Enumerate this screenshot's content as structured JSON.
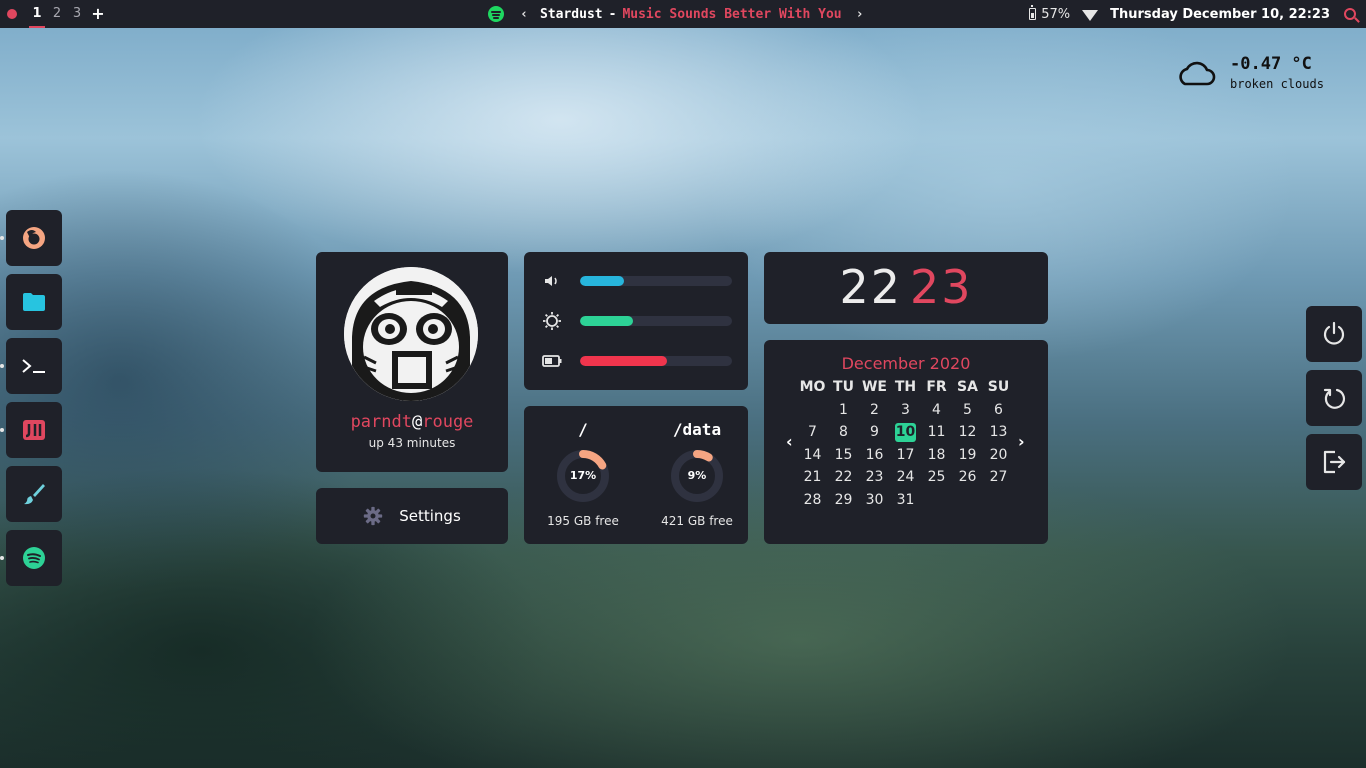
{
  "topbar": {
    "workspaces": [
      "1",
      "2",
      "3"
    ],
    "add_label": "+",
    "now_playing": {
      "artist": "Stardust",
      "separator": "-",
      "title": "Music Sounds Better With You",
      "prev_label": "‹",
      "next_label": "›"
    },
    "battery": "57%",
    "datetime": "Thursday December 10, 22:23"
  },
  "weather": {
    "temperature": "-0.47 °C",
    "description": "broken clouds",
    "icon": "cloud-icon"
  },
  "dock": [
    {
      "name": "firefox",
      "icon": "firefox-icon",
      "color": "#f5a582"
    },
    {
      "name": "files",
      "icon": "folder-icon",
      "color": "#27c4e0"
    },
    {
      "name": "terminal",
      "icon": "terminal-icon",
      "color": "#ffffff"
    },
    {
      "name": "jetbrains",
      "icon": "jetbrains-icon",
      "color": "#e0475f"
    },
    {
      "name": "paint",
      "icon": "brush-icon",
      "color": "#6fd1dd"
    },
    {
      "name": "spotify",
      "icon": "spotify-icon",
      "color": "#2dd296"
    }
  ],
  "profile": {
    "user": "parndt",
    "at": "@",
    "host": "rouge",
    "uptime": "up 43 minutes"
  },
  "settings": {
    "label": "Settings"
  },
  "sliders": {
    "volume": {
      "icon": "volume-icon",
      "level": 0.29,
      "color": "#27b5dc"
    },
    "brightness": {
      "icon": "brightness-icon",
      "level": 0.35,
      "color": "#2dd296"
    },
    "battery": {
      "icon": "battery-icon",
      "level": 0.57,
      "color": "#f0354d"
    }
  },
  "disks": [
    {
      "mount": "/",
      "percent_label": "17%",
      "percent": 17,
      "free": "195 GB free"
    },
    {
      "mount": "/data",
      "percent_label": "9%",
      "percent": 9,
      "free": "421 GB free"
    }
  ],
  "clock": {
    "hours": "22",
    "minutes": "23"
  },
  "calendar": {
    "title": "December 2020",
    "weekdays": [
      "MO",
      "TU",
      "WE",
      "TH",
      "FR",
      "SA",
      "SU"
    ],
    "first_weekday_index": 1,
    "days_in_month": 31,
    "today": 10,
    "prev_label": "‹",
    "next_label": "›"
  },
  "power": [
    {
      "name": "power",
      "icon": "power-icon"
    },
    {
      "name": "restart",
      "icon": "restart-icon"
    },
    {
      "name": "logout",
      "icon": "logout-icon"
    }
  ],
  "colors": {
    "accent": "#e0475f",
    "green": "#2dd296",
    "cyan": "#27b5dc",
    "panel": "#1f2129",
    "donut_fill": "#f5a582",
    "donut_track": "#2f3240"
  }
}
